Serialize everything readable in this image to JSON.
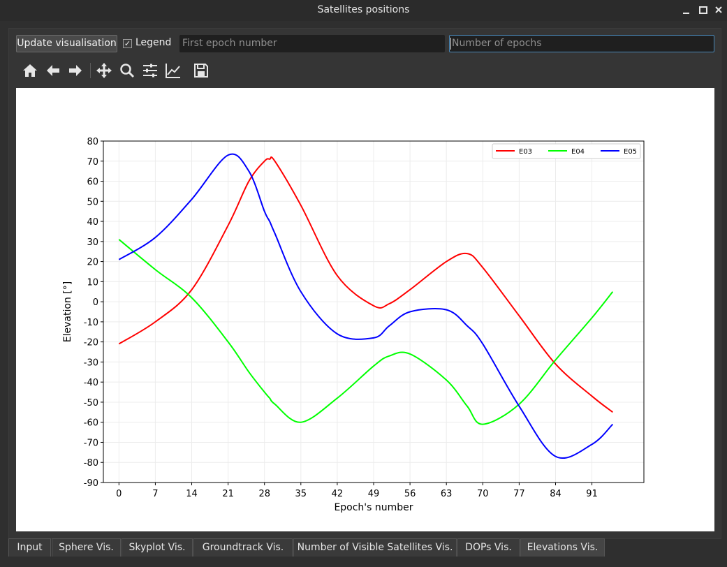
{
  "window": {
    "title": "Satellites positions"
  },
  "controls": {
    "update_label": "Update visualisation",
    "legend_checked": "✓",
    "legend_label": "Legend",
    "first_epoch_placeholder": "First epoch number",
    "epoch_count_placeholder": "Number of epochs"
  },
  "toolbar": {
    "icons": [
      "home-icon",
      "back-arrow-icon",
      "forward-arrow-icon",
      "pan-icon",
      "zoom-icon",
      "configure-subplots-icon",
      "edit-axis-icon",
      "save-icon"
    ]
  },
  "tabs": [
    {
      "label": "Input"
    },
    {
      "label": "Sphere Vis."
    },
    {
      "label": "Skyplot Vis."
    },
    {
      "label": "Groundtrack Vis."
    },
    {
      "label": "Number of Visible Satellites Vis."
    },
    {
      "label": "DOPs Vis."
    },
    {
      "label": "Elevations Vis."
    }
  ],
  "active_tab": "Elevations Vis.",
  "chart_data": {
    "type": "line",
    "title": "",
    "xlabel": "Epoch's number",
    "ylabel": "Elevation [°]",
    "xlim": [
      -3,
      101
    ],
    "ylim": [
      -90,
      80
    ],
    "xticks": [
      0,
      7,
      14,
      21,
      28,
      35,
      42,
      49,
      56,
      63,
      70,
      77,
      84,
      91
    ],
    "yticks": [
      80,
      70,
      60,
      50,
      40,
      30,
      20,
      10,
      0,
      -10,
      -20,
      -30,
      -40,
      -50,
      -60,
      -70,
      -80,
      -90
    ],
    "grid": true,
    "legend_position": "top-right",
    "x": [
      0,
      7,
      14,
      21,
      25,
      28,
      29,
      30,
      35,
      42,
      49,
      52,
      56,
      63,
      67,
      70,
      77,
      84,
      91,
      95
    ],
    "series": [
      {
        "name": "E03",
        "color": "#ff0000",
        "values": [
          -21,
          -10,
          6,
          38,
          60,
          70,
          71,
          70,
          48,
          13,
          -2,
          -1,
          6,
          20,
          24,
          17,
          -7,
          -31,
          -47,
          -55
        ]
      },
      {
        "name": "E04",
        "color": "#00ff00",
        "values": [
          31,
          16,
          2,
          -20,
          -35,
          -45,
          -48,
          -51,
          -60,
          -48,
          -32,
          -27,
          -26,
          -39,
          -52,
          -61,
          -51,
          -29,
          -8,
          5
        ]
      },
      {
        "name": "E05",
        "color": "#0000ff",
        "values": [
          21,
          32,
          51,
          73,
          65,
          45,
          40,
          34,
          5,
          -16,
          -18,
          -12,
          -5,
          -4,
          -12,
          -21,
          -52,
          -77,
          -71,
          -61
        ]
      }
    ]
  }
}
